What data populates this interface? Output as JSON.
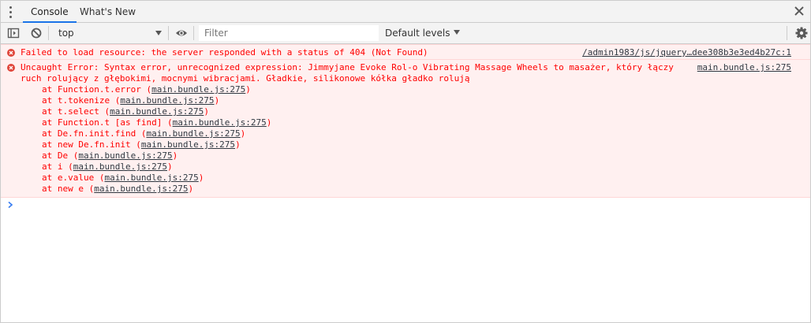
{
  "tabs": {
    "console": "Console",
    "whats_new": "What's New"
  },
  "toolbar": {
    "context": "top",
    "filter_placeholder": "Filter",
    "levels": "Default levels"
  },
  "messages": [
    {
      "text": "Failed to load resource: the server responded with a status of 404 (Not Found)",
      "source": "/admin1983/js/jquery…dee308b3e3ed4b27c:1"
    },
    {
      "text": "Uncaught Error: Syntax error, unrecognized expression: Jimmyjane Evoke Rol-o Vibrating Massage Wheels to masażer, który łączy\nruch rolujący z głębokimi, mocnymi wibracjami. Gładkie, silikonowe kółka gładko rolują",
      "source": "main.bundle.js:275",
      "stack": [
        {
          "prefix": "at Function.t.error (",
          "link": "main.bundle.js:275",
          "suffix": ")"
        },
        {
          "prefix": "at t.tokenize (",
          "link": "main.bundle.js:275",
          "suffix": ")"
        },
        {
          "prefix": "at t.select (",
          "link": "main.bundle.js:275",
          "suffix": ")"
        },
        {
          "prefix": "at Function.t [as find] (",
          "link": "main.bundle.js:275",
          "suffix": ")"
        },
        {
          "prefix": "at De.fn.init.find (",
          "link": "main.bundle.js:275",
          "suffix": ")"
        },
        {
          "prefix": "at new De.fn.init (",
          "link": "main.bundle.js:275",
          "suffix": ")"
        },
        {
          "prefix": "at De (",
          "link": "main.bundle.js:275",
          "suffix": ")"
        },
        {
          "prefix": "at i (",
          "link": "main.bundle.js:275",
          "suffix": ")"
        },
        {
          "prefix": "at e.value (",
          "link": "main.bundle.js:275",
          "suffix": ")"
        },
        {
          "prefix": "at new e (",
          "link": "main.bundle.js:275",
          "suffix": ")"
        }
      ]
    }
  ],
  "icons": {
    "menu": "kebab-menu-icon",
    "close": "close-icon",
    "sidebar": "sidebar-toggle-icon",
    "clear": "clear-console-icon",
    "eye": "eye-icon",
    "settings": "gear-icon",
    "error": "error-icon",
    "prompt": "chevron-right-icon"
  },
  "colors": {
    "error_text": "#ff0000",
    "error_bg": "#fff0f0",
    "link": "#303942",
    "accent": "#1a73e8",
    "prompt": "#367cf1"
  }
}
